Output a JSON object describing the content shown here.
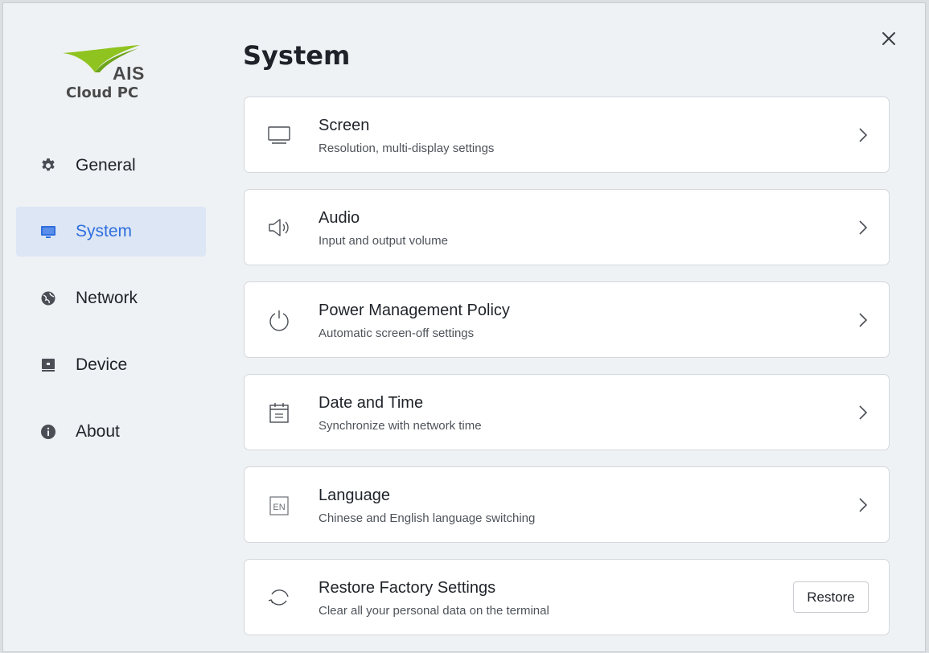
{
  "logo": {
    "brand": "AIS",
    "product": "Cloud PC"
  },
  "sidebar": {
    "items": [
      {
        "label": "General",
        "icon": "gear-icon"
      },
      {
        "label": "System",
        "icon": "monitor-icon",
        "active": true
      },
      {
        "label": "Network",
        "icon": "globe-icon"
      },
      {
        "label": "Device",
        "icon": "device-icon"
      },
      {
        "label": "About",
        "icon": "info-icon"
      }
    ]
  },
  "main": {
    "title": "System",
    "cards": [
      {
        "title": "Screen",
        "subtitle": "Resolution, multi-display settings",
        "icon": "monitor-outline-icon"
      },
      {
        "title": "Audio",
        "subtitle": "Input and output volume",
        "icon": "speaker-icon"
      },
      {
        "title": "Power Management Policy",
        "subtitle": "Automatic screen-off settings",
        "icon": "power-icon"
      },
      {
        "title": "Date and Time",
        "subtitle": "Synchronize with network time",
        "icon": "calendar-icon"
      },
      {
        "title": "Language",
        "subtitle": "Chinese and English language switching",
        "icon": "language-icon",
        "icon_text": "EN"
      },
      {
        "title": "Restore Factory Settings",
        "subtitle": "Clear all your personal data on the terminal",
        "icon": "restore-icon",
        "button": "Restore"
      }
    ]
  },
  "colors": {
    "accent": "#2f6fde",
    "active_bg": "#dde6f4",
    "logo_green": "#8fc31f",
    "background": "#eff2f5"
  }
}
